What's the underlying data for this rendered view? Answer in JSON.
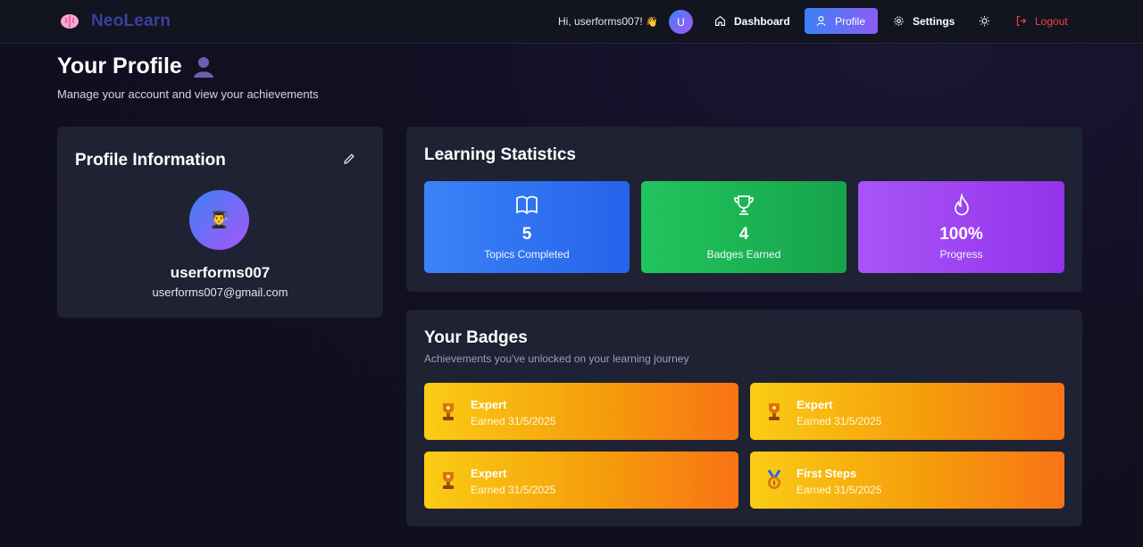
{
  "nav": {
    "brand": "NeoLearn",
    "greeting": "Hi, userforms007!",
    "greeting_emoji": "👋",
    "avatar_initial": "U",
    "items": [
      {
        "label": "Dashboard",
        "icon": "home-icon"
      },
      {
        "label": "Profile",
        "icon": "user-icon"
      },
      {
        "label": "Settings",
        "icon": "gear-icon"
      },
      {
        "label": "",
        "icon": "sun-icon"
      },
      {
        "label": "Logout",
        "icon": "logout-icon"
      }
    ]
  },
  "page": {
    "title": "Your Profile",
    "subtitle": "Manage your account and view your achievements"
  },
  "profile": {
    "heading": "Profile Information",
    "avatar_emoji": "👨‍🎓",
    "username": "userforms007",
    "email": "userforms007@gmail.com"
  },
  "stats": {
    "heading": "Learning Statistics",
    "items": [
      {
        "value": "5",
        "label": "Topics Completed",
        "icon": "book-icon",
        "color": "#3b82f6"
      },
      {
        "value": "4",
        "label": "Badges Earned",
        "icon": "trophy-icon",
        "color": "#22c55e"
      },
      {
        "value": "100%",
        "label": "Progress",
        "icon": "flame-icon",
        "color": "#a855f7"
      }
    ]
  },
  "badges": {
    "heading": "Your Badges",
    "subtitle": "Achievements you've unlocked on your learning journey",
    "items": [
      {
        "name": "Expert",
        "date": "Earned 31/5/2025",
        "icon": "trophy-award-icon"
      },
      {
        "name": "Expert",
        "date": "Earned 31/5/2025",
        "icon": "trophy-award-icon"
      },
      {
        "name": "Expert",
        "date": "Earned 31/5/2025",
        "icon": "trophy-award-icon"
      },
      {
        "name": "First Steps",
        "date": "Earned 31/5/2025",
        "icon": "medal-icon"
      }
    ]
  },
  "colors": {
    "accent_start": "#3b82f6",
    "accent_end": "#8b5cf6",
    "logout": "#ef4444",
    "badge_gradient": [
      "#facc15",
      "#f97316"
    ]
  }
}
